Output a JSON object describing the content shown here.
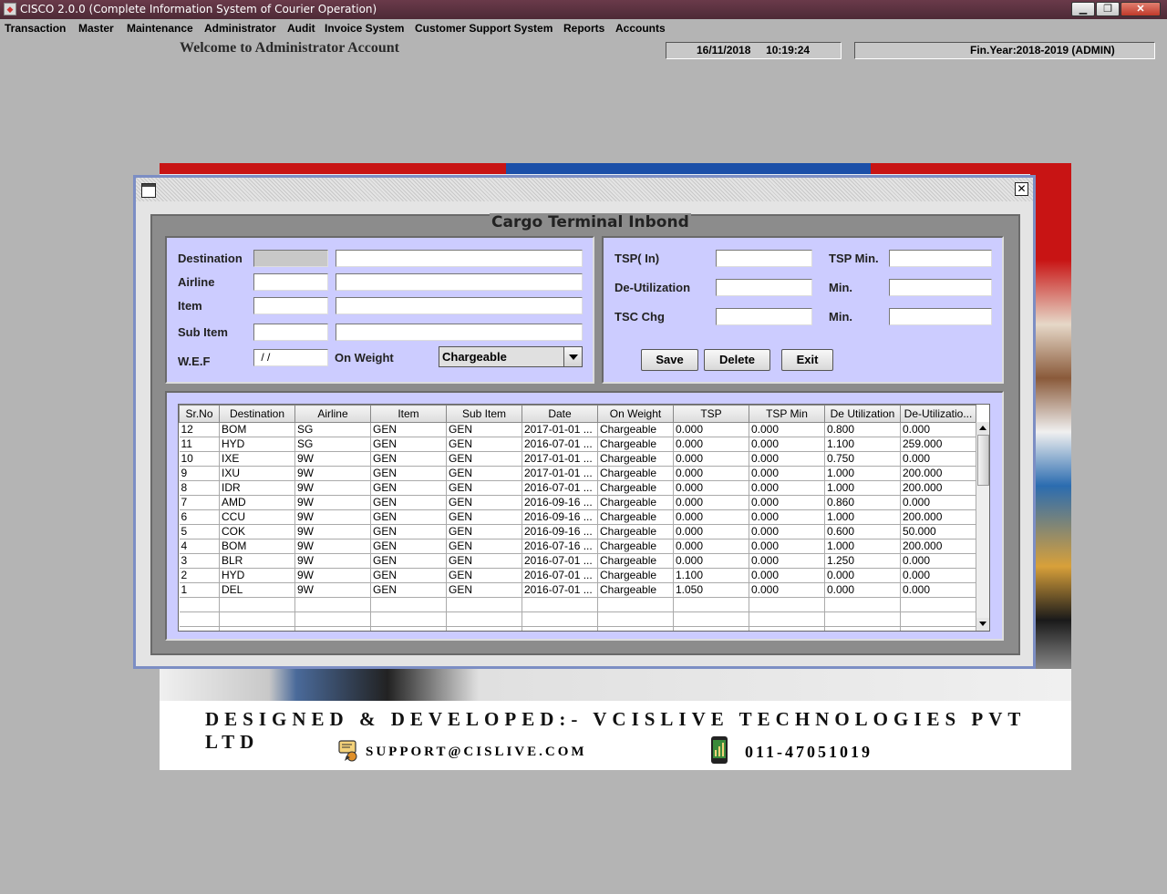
{
  "app": {
    "title": "CISCO 2.0.0 (Complete Information System of Courier Operation)"
  },
  "window_controls": {
    "minimize": "▁",
    "maximize": "❐",
    "close": "✕"
  },
  "menu": [
    "Transaction",
    "Master",
    "Maintenance",
    "Administrator",
    "Audit",
    "Invoice System",
    "Customer Support System",
    "Reports",
    "Accounts"
  ],
  "header": {
    "welcome": "Welcome to Administrator Account",
    "datetime": "16/11/2018     10:19:24",
    "finyear": "Fin.Year:2018-2019  (ADMIN)"
  },
  "banner": {
    "designed": "DESIGNED & DEVELOPED:- VCISLIVE TECHNOLOGIES PVT LTD",
    "support": "SUPPORT@CISLIVE.COM",
    "phone": "011-47051019"
  },
  "form": {
    "title": "Cargo Terminal Inbond",
    "labels": {
      "destination": "Destination",
      "airline": "Airline",
      "item": "Item",
      "sub_item": "Sub Item",
      "wef": "W.E.F",
      "on_weight": "On Weight",
      "tsp_in": "TSP( In)",
      "tsp_min": "TSP Min.",
      "de_utilization": "De-Utilization",
      "min1": "Min.",
      "tsc_chg": "TSC Chg",
      "min2": "Min."
    },
    "values": {
      "wef": " / /",
      "on_weight": "Chargeable"
    },
    "buttons": {
      "save": "Save",
      "delete": "Delete",
      "exit": "Exit"
    }
  },
  "table": {
    "columns": [
      "Sr.No",
      "Destination",
      "Airline",
      "Item",
      "Sub Item",
      "Date",
      "On Weight",
      "TSP",
      "TSP Min",
      "De Utilization",
      "De-Utilizatio..."
    ],
    "rows": [
      [
        "12",
        "BOM",
        "SG",
        "GEN",
        "GEN",
        "2017-01-01 ...",
        "Chargeable",
        "0.000",
        "0.000",
        "0.800",
        "0.000"
      ],
      [
        "11",
        "HYD",
        "SG",
        "GEN",
        "GEN",
        "2016-07-01 ...",
        "Chargeable",
        "0.000",
        "0.000",
        "1.100",
        "259.000"
      ],
      [
        "10",
        "IXE",
        "9W",
        "GEN",
        "GEN",
        "2017-01-01 ...",
        "Chargeable",
        "0.000",
        "0.000",
        "0.750",
        "0.000"
      ],
      [
        "9",
        "IXU",
        "9W",
        "GEN",
        "GEN",
        "2017-01-01 ...",
        "Chargeable",
        "0.000",
        "0.000",
        "1.000",
        "200.000"
      ],
      [
        "8",
        "IDR",
        "9W",
        "GEN",
        "GEN",
        "2016-07-01 ...",
        "Chargeable",
        "0.000",
        "0.000",
        "1.000",
        "200.000"
      ],
      [
        "7",
        "AMD",
        "9W",
        "GEN",
        "GEN",
        "2016-09-16 ...",
        "Chargeable",
        "0.000",
        "0.000",
        "0.860",
        "0.000"
      ],
      [
        "6",
        "CCU",
        "9W",
        "GEN",
        "GEN",
        "2016-09-16 ...",
        "Chargeable",
        "0.000",
        "0.000",
        "1.000",
        "200.000"
      ],
      [
        "5",
        "COK",
        "9W",
        "GEN",
        "GEN",
        "2016-09-16 ...",
        "Chargeable",
        "0.000",
        "0.000",
        "0.600",
        "50.000"
      ],
      [
        "4",
        "BOM",
        "9W",
        "GEN",
        "GEN",
        "2016-07-16 ...",
        "Chargeable",
        "0.000",
        "0.000",
        "1.000",
        "200.000"
      ],
      [
        "3",
        "BLR",
        "9W",
        "GEN",
        "GEN",
        "2016-07-01 ...",
        "Chargeable",
        "0.000",
        "0.000",
        "1.250",
        "0.000"
      ],
      [
        "2",
        "HYD",
        "9W",
        "GEN",
        "GEN",
        "2016-07-01 ...",
        "Chargeable",
        "1.100",
        "0.000",
        "0.000",
        "0.000"
      ],
      [
        "1",
        "DEL",
        "9W",
        "GEN",
        "GEN",
        "2016-07-01 ...",
        "Chargeable",
        "1.050",
        "0.000",
        "0.000",
        "0.000"
      ]
    ]
  }
}
